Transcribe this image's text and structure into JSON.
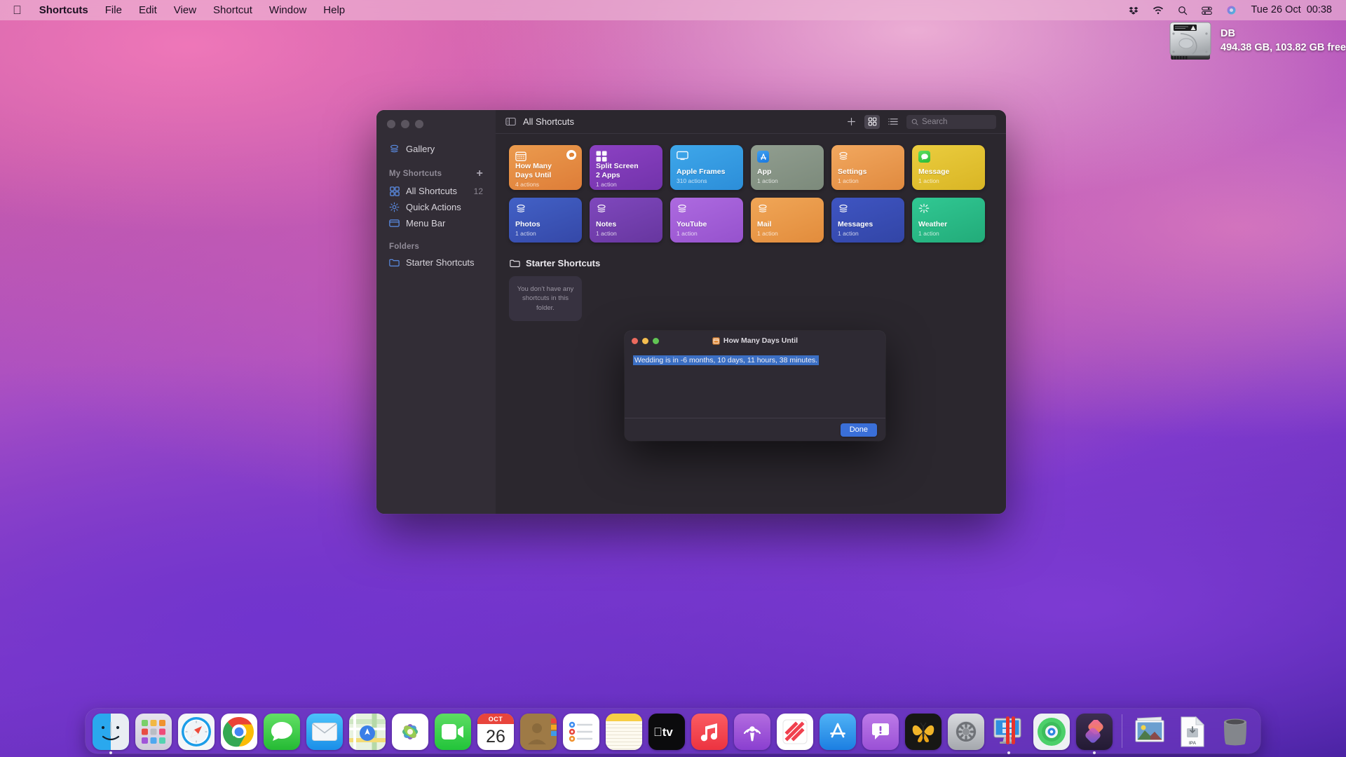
{
  "menubar": {
    "apple_icon": "apple-logo",
    "items": [
      "Shortcuts",
      "File",
      "Edit",
      "View",
      "Shortcut",
      "Window",
      "Help"
    ],
    "status_icons": [
      "dropbox-icon",
      "wifi-icon",
      "search-icon",
      "control-center-icon",
      "siri-icon"
    ],
    "clock": "Tue 26 Oct  00:38"
  },
  "desktop": {
    "drive": {
      "icon": "hard-drive-icon",
      "name": "DB",
      "capacity": "494.38 GB, 103.82 GB free"
    }
  },
  "window": {
    "sidebar": {
      "gallery": {
        "label": "Gallery",
        "icon": "gallery-icon"
      },
      "my_shortcuts_header": "My Shortcuts",
      "add_label": "+",
      "items": [
        {
          "label": "All Shortcuts",
          "icon": "grid-icon",
          "count": "12",
          "selected": true
        },
        {
          "label": "Quick Actions",
          "icon": "gear-icon",
          "count": ""
        },
        {
          "label": "Menu Bar",
          "icon": "menubar-icon",
          "count": ""
        }
      ],
      "folders_header": "Folders",
      "folders": [
        {
          "label": "Starter Shortcuts",
          "icon": "folder-icon"
        }
      ]
    },
    "toolbar": {
      "sidebar_toggle_icon": "sidebar-toggle-icon",
      "title": "All Shortcuts",
      "add_icon": "plus-icon",
      "grid_view_icon": "grid-view-icon",
      "list_view_icon": "list-view-icon",
      "search_icon": "search-icon",
      "search_placeholder": "Search",
      "search_value": ""
    },
    "shortcuts": [
      {
        "name": "How Many\nDays Until",
        "actions": "4 actions",
        "color_from": "#eb9b4e",
        "color_to": "#e07f3c",
        "icon": "calendar-icon",
        "badge": "quick-action-badge"
      },
      {
        "name": "Split Screen\n2 Apps",
        "actions": "1 action",
        "color_from": "#8a3fc0",
        "color_to": "#7435ad",
        "icon": "grid-squares-icon",
        "badge": ""
      },
      {
        "name": "Apple Frames",
        "actions": "310 actions",
        "color_from": "#3aa3e8",
        "color_to": "#2e92dd",
        "icon": "display-icon",
        "badge": ""
      },
      {
        "name": "App",
        "actions": "1 action",
        "color_from": "#8d9a8c",
        "color_to": "#7e8c7d",
        "icon": "app-store-icon",
        "badge": ""
      },
      {
        "name": "Settings",
        "actions": "1 action",
        "color_from": "#f0a55c",
        "color_to": "#e2873f",
        "icon": "stack-icon",
        "badge": ""
      },
      {
        "name": "Message",
        "actions": "1 action",
        "color_from": "#e8c93a",
        "color_to": "#dcb827",
        "icon": "messages-app-icon",
        "badge": ""
      },
      {
        "name": "Photos",
        "actions": "1 action",
        "color_from": "#3f5bc0",
        "color_to": "#3a51ae",
        "icon": "stack-icon",
        "badge": ""
      },
      {
        "name": "Notes",
        "actions": "1 action",
        "color_from": "#7b43b8",
        "color_to": "#6b3aa4",
        "icon": "stack-icon",
        "badge": ""
      },
      {
        "name": "YouTube",
        "actions": "1 action",
        "color_from": "#a965dd",
        "color_to": "#9a56d0",
        "icon": "stack-icon",
        "badge": ""
      },
      {
        "name": "Mail",
        "actions": "1 action",
        "color_from": "#efa354",
        "color_to": "#e38f3f",
        "icon": "stack-icon",
        "badge": ""
      },
      {
        "name": "Messages",
        "actions": "1 action",
        "color_from": "#3c51bd",
        "color_to": "#3448ac",
        "icon": "stack-icon",
        "badge": ""
      },
      {
        "name": "Weather",
        "actions": "1 action",
        "color_from": "#2fc48f",
        "color_to": "#25b07e",
        "icon": "sparkle-icon",
        "badge": ""
      }
    ],
    "folder_section": {
      "icon": "folder-icon",
      "title": "Starter Shortcuts",
      "empty_message": "You don’t have any shortcuts in this folder."
    }
  },
  "modal": {
    "icon": "calendar-icon",
    "title": "How Many Days Until",
    "message": "Wedding is in -6 months, 10 days, 11 hours, 38 minutes.",
    "done_label": "Done",
    "traffic": {
      "close": "#ec6a5e",
      "minimize": "#f4bd4f",
      "zoom": "#61c554"
    },
    "highlight_color": "#3b6fc4"
  },
  "dock": {
    "items": [
      {
        "name": "Finder",
        "icon": "finder-icon",
        "running": true
      },
      {
        "name": "Launchpad",
        "icon": "launchpad-icon",
        "running": false
      },
      {
        "name": "Safari",
        "icon": "safari-icon",
        "running": false
      },
      {
        "name": "Google Chrome",
        "icon": "chrome-icon",
        "running": false
      },
      {
        "name": "Messages",
        "icon": "messages-icon",
        "running": false
      },
      {
        "name": "Mail",
        "icon": "mail-icon",
        "running": false
      },
      {
        "name": "Maps",
        "icon": "maps-icon",
        "running": false
      },
      {
        "name": "Photos",
        "icon": "photos-icon",
        "running": false
      },
      {
        "name": "FaceTime",
        "icon": "facetime-icon",
        "running": false
      },
      {
        "name": "Calendar",
        "icon": "calendar-icon",
        "running": false,
        "month": "OCT",
        "day": "26"
      },
      {
        "name": "Contacts",
        "icon": "contacts-icon",
        "running": false
      },
      {
        "name": "Reminders",
        "icon": "reminders-icon",
        "running": false
      },
      {
        "name": "Notes",
        "icon": "notes-icon",
        "running": false
      },
      {
        "name": "TV",
        "icon": "appletv-icon",
        "running": false
      },
      {
        "name": "Music",
        "icon": "music-icon",
        "running": false
      },
      {
        "name": "Podcasts",
        "icon": "podcasts-icon",
        "running": false
      },
      {
        "name": "News",
        "icon": "news-icon",
        "running": false
      },
      {
        "name": "App Store",
        "icon": "app-store-icon",
        "running": false
      },
      {
        "name": "Alert App",
        "icon": "alert-bubble-icon",
        "running": false
      },
      {
        "name": "Tower",
        "icon": "butterfly-icon",
        "running": false
      },
      {
        "name": "System Preferences",
        "icon": "system-preferences-icon",
        "running": false
      },
      {
        "name": "Parallels Desktop",
        "icon": "parallels-icon",
        "running": true
      },
      {
        "name": "Find My",
        "icon": "findmy-icon",
        "running": false
      },
      {
        "name": "Shortcuts",
        "icon": "shortcuts-icon",
        "running": true
      }
    ],
    "files": [
      {
        "name": "Pictures",
        "icon": "pictures-stack-icon"
      },
      {
        "name": "IPA file",
        "icon": "ipa-file-icon",
        "label": "IPA"
      },
      {
        "name": "Trash",
        "icon": "trash-icon"
      }
    ]
  }
}
